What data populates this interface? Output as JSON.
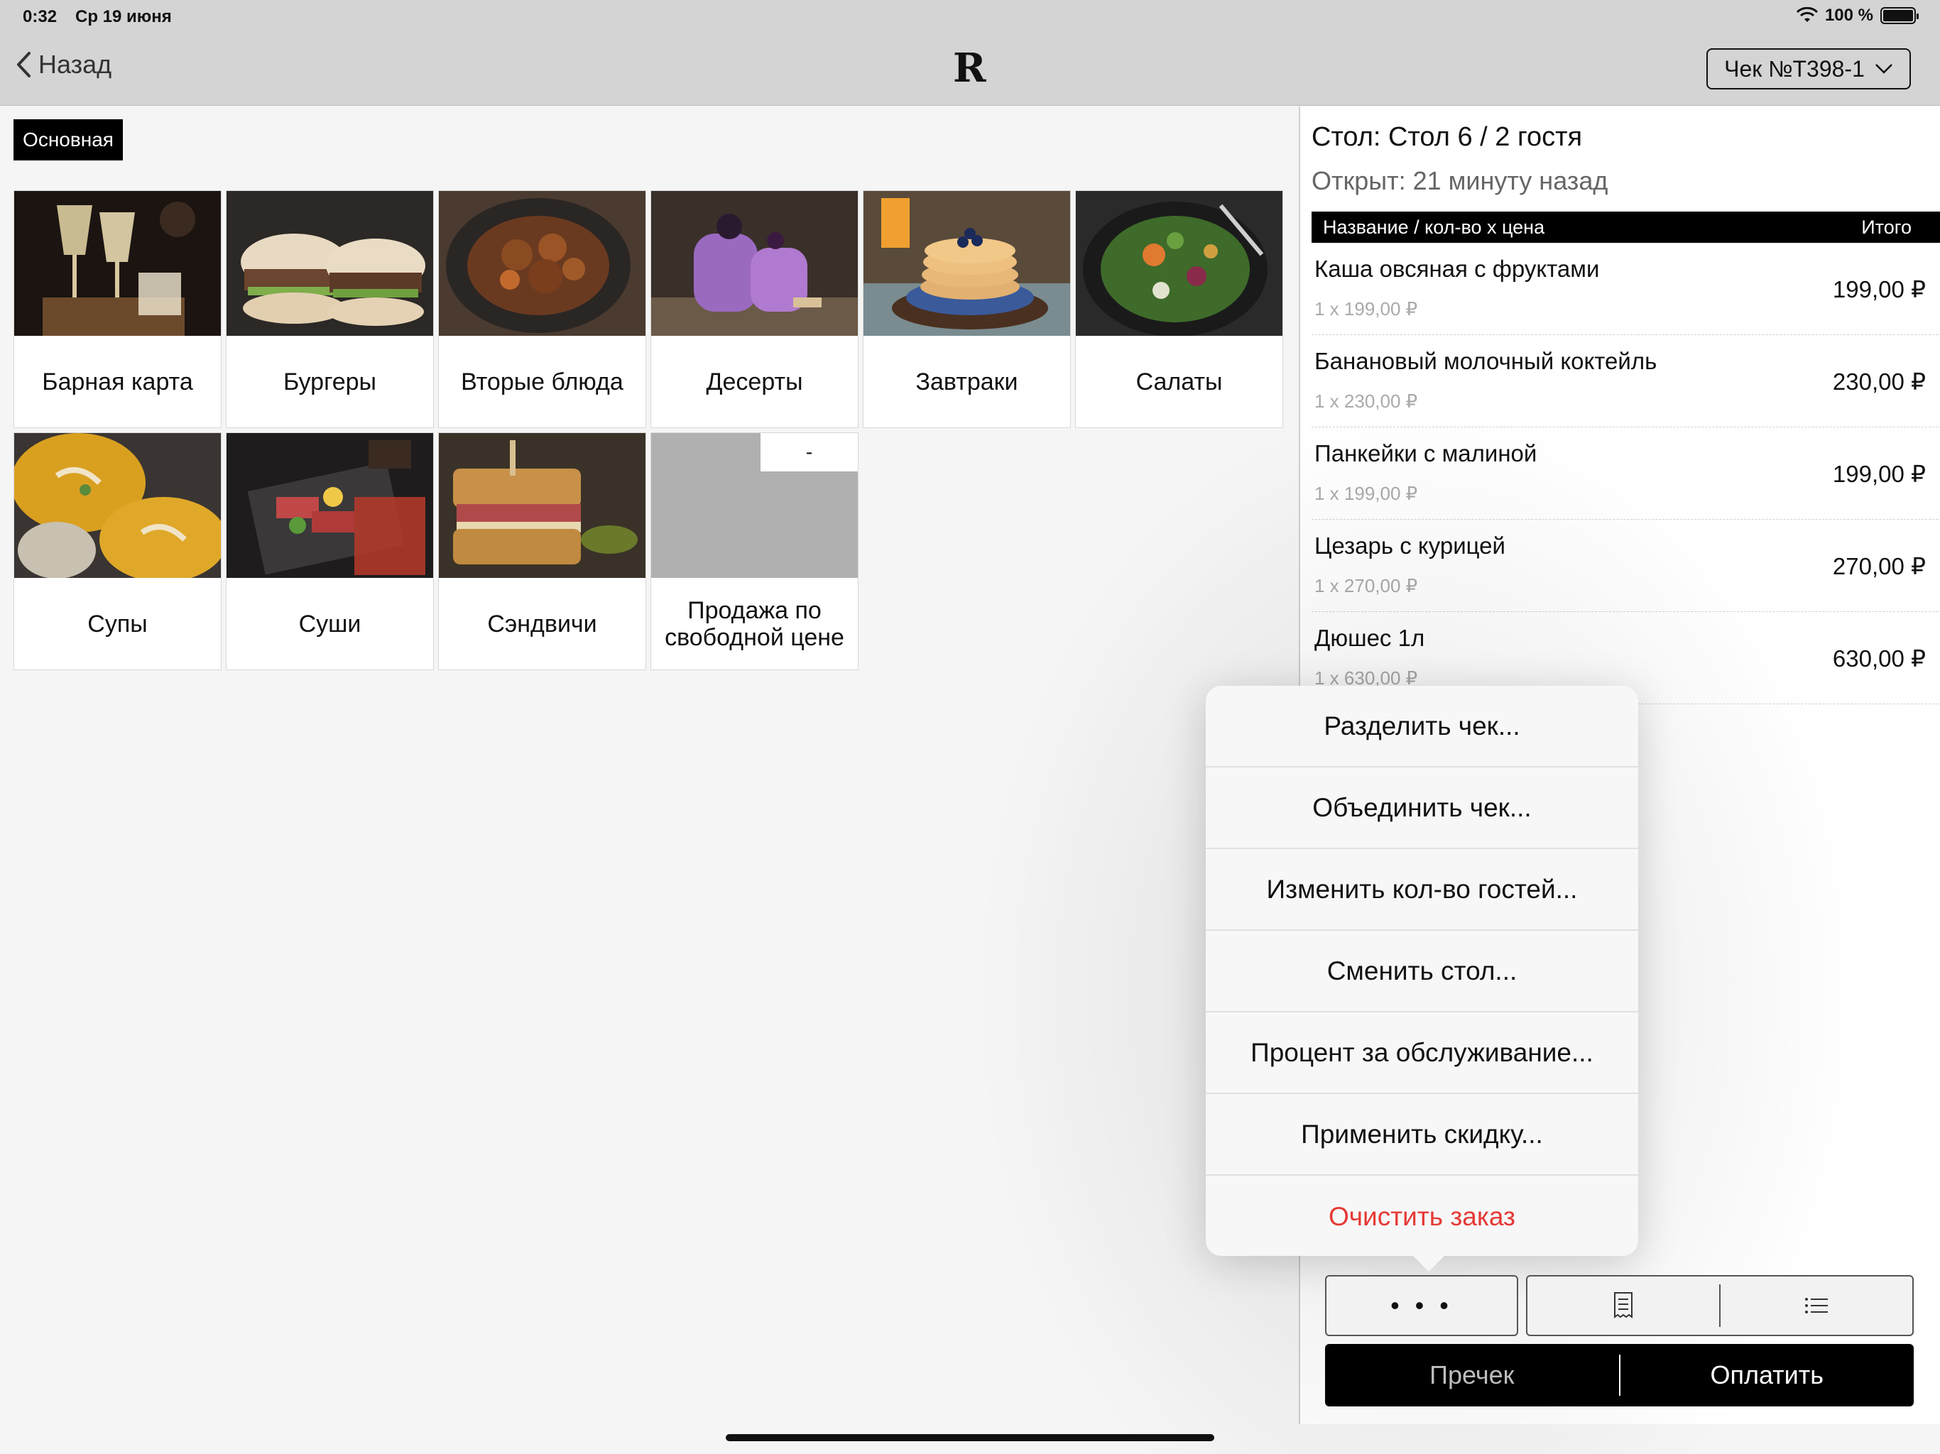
{
  "status": {
    "time": "0:32",
    "date": "Ср 19 июня",
    "battery": "100 %"
  },
  "header": {
    "back_label": "Назад",
    "check_label": "Чек №T398-1",
    "logo_letter": "R"
  },
  "menu_tab": "Основная",
  "categories": [
    {
      "label": "Барная карта"
    },
    {
      "label": "Бургеры"
    },
    {
      "label": "Вторые блюда"
    },
    {
      "label": "Десерты"
    },
    {
      "label": "Завтраки"
    },
    {
      "label": "Салаты"
    },
    {
      "label": "Супы"
    },
    {
      "label": "Суши"
    },
    {
      "label": "Сэндвичи"
    },
    {
      "label": "Продажа по свободной цене",
      "badge": "-"
    }
  ],
  "order": {
    "table": "Стол: Стол 6 / 2 гостя",
    "opened": "Открыт: 21 минуту назад",
    "col_name": "Название / кол-во x цена",
    "col_total": "Итого",
    "items": [
      {
        "name": "Каша овсяная с фруктами",
        "qty": "1 x 199,00 ₽",
        "total": "199,00 ₽"
      },
      {
        "name": "Банановый молочный коктейль",
        "qty": "1 x 230,00 ₽",
        "total": "230,00 ₽"
      },
      {
        "name": "Панкейки с малиной",
        "qty": "1 x 199,00 ₽",
        "total": "199,00 ₽"
      },
      {
        "name": "Цезарь с курицей",
        "qty": "1 x 270,00 ₽",
        "total": "270,00 ₽"
      },
      {
        "name": "Дюшес 1л",
        "qty": "1 x 630,00 ₽",
        "total": "630,00 ₽"
      }
    ]
  },
  "popover": {
    "items": [
      "Разделить чек...",
      "Объединить чек...",
      "Изменить кол-во гостей...",
      "Сменить стол...",
      "Процент за обслуживание...",
      "Применить скидку...",
      "Очистить заказ"
    ],
    "danger_color": "#e53935"
  },
  "actions": {
    "more_label": "• • •",
    "precheck": "Пречек",
    "pay": "Оплатить"
  }
}
